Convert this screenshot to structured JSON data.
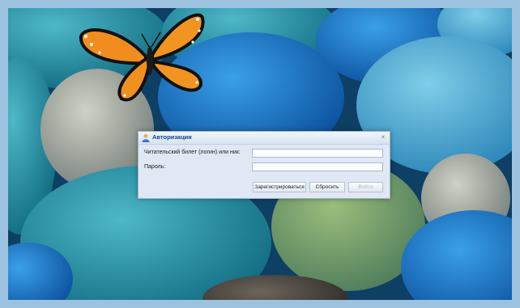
{
  "dialog": {
    "title": "Авторизация",
    "login_label": "Читательский билет (логин) или ник:",
    "login_value": "",
    "password_label": "Пароль:",
    "password_value": "",
    "close_symbol": "×",
    "buttons": {
      "register": "Зарегистрироваться",
      "reset": "Сбросить",
      "login": "Войти"
    }
  },
  "colors": {
    "title_text": "#15428b",
    "dialog_bg": "#dfe8f3",
    "frame": "#9cc2df"
  }
}
